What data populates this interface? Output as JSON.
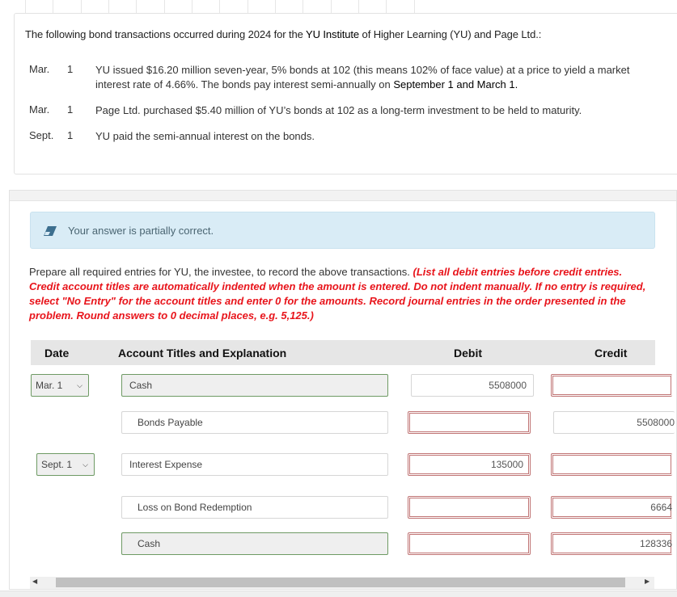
{
  "problem": {
    "intro_prefix": "The following bond transactions occurred during 2024 for the ",
    "intro_entity": "YU Institute",
    "intro_suffix": " of Higher Learning (YU) and Page Ltd.:",
    "transactions": [
      {
        "month": "Mar.",
        "day": "1",
        "text_line1": "YU issued $16.20 million seven-year, 5% bonds at 102 (this means 102% of face value) at a price to yield a market",
        "text_line2_prefix": "interest rate of 4.66%. The bonds pay interest semi-annually on ",
        "text_line2_emph": "September 1 and March 1."
      },
      {
        "month": "Mar.",
        "day": "1",
        "text": "Page Ltd. purchased $5.40 million of YU’s bonds at 102 as a long-term investment to be held to maturity."
      },
      {
        "month": "Sept.",
        "day": "1",
        "text": "YU paid the semi-annual interest on the bonds."
      }
    ]
  },
  "feedback": {
    "icon": "eraser-icon",
    "message": "Your answer is partially correct."
  },
  "instructions": {
    "plain": "Prepare all required entries for YU, the investee, to record the above transactions. ",
    "emphasis": "(List all debit entries before credit entries. Credit account titles are automatically indented when the amount is entered. Do not indent manually. If no entry is required, select \"No Entry\" for the account titles and enter 0 for the amounts. Record journal entries in the order presented in the problem. Round answers to 0 decimal places, e.g. 5,125.)"
  },
  "journal": {
    "headers": {
      "date": "Date",
      "account": "Account Titles and Explanation",
      "debit": "Debit",
      "credit": "Credit"
    },
    "rows": [
      {
        "date": "Mar. 1",
        "account": "Cash",
        "debit": "5508000",
        "credit": "",
        "account_status": "correct",
        "debit_status": "neutral",
        "credit_status": "incorrect"
      },
      {
        "date": "",
        "account": "Bonds Payable",
        "debit": "",
        "credit": "5508000",
        "account_status": "neutral",
        "debit_status": "incorrect",
        "credit_status": "neutral"
      },
      {
        "date": "Sept. 1",
        "account": "Interest Expense",
        "debit": "135000",
        "credit": "",
        "account_status": "neutral",
        "debit_status": "incorrect",
        "credit_status": "incorrect"
      },
      {
        "date": "",
        "account": "Loss on Bond Redemption",
        "debit": "",
        "credit": "6664",
        "account_status": "neutral",
        "debit_status": "incorrect",
        "credit_status": "incorrect"
      },
      {
        "date": "",
        "account": "Cash",
        "debit": "",
        "credit": "128336",
        "account_status": "correct",
        "debit_status": "incorrect",
        "credit_status": "incorrect"
      }
    ]
  },
  "colors": {
    "correct_border": "#6e9a64",
    "incorrect_border": "#c07474",
    "instruction_red": "#e8141b",
    "feedback_bg": "#d9ecf6"
  }
}
